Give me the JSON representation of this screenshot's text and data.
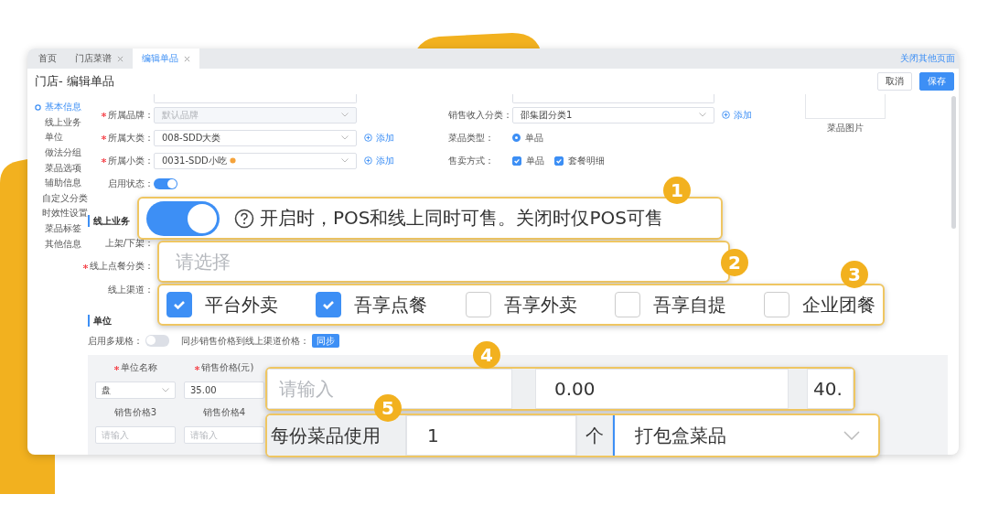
{
  "tabs": [
    {
      "label": "首页",
      "closable": false,
      "selected": false
    },
    {
      "label": "门店菜谱",
      "closable": true,
      "selected": false
    },
    {
      "label": "编辑单品",
      "closable": true,
      "selected": true
    }
  ],
  "tab_bar_link": "关闭其他页面",
  "page_title": "门店- 编辑单品",
  "header_buttons": [
    {
      "label": "取消",
      "kind": "default"
    },
    {
      "label": "保存",
      "kind": "primary"
    }
  ],
  "sidebar": {
    "items": [
      {
        "label": "基本信息",
        "selected": true
      },
      {
        "label": "线上业务",
        "selected": false
      },
      {
        "label": "单位",
        "selected": false
      },
      {
        "label": "做法分组",
        "selected": false
      },
      {
        "label": "菜品选项",
        "selected": false
      },
      {
        "label": "辅助信息",
        "selected": false
      },
      {
        "label": "自定义分类",
        "selected": false
      },
      {
        "label": "时效性设置",
        "selected": false
      },
      {
        "label": "菜品标签",
        "selected": false
      },
      {
        "label": "其他信息",
        "selected": false
      }
    ]
  },
  "basic_info": {
    "left_fields": [
      {
        "label": "所属品牌：",
        "required": true,
        "value": "默认品牌",
        "disabled": true
      },
      {
        "label": "所属大类：",
        "required": true,
        "value": "008-SDD大类",
        "disabled": false,
        "add_label": "添加"
      },
      {
        "label": "所属小类：",
        "required": true,
        "value": "0031-SDD小吃",
        "disabled": false,
        "add_label": "添加",
        "value_icon": true
      }
    ],
    "right_fields": [
      {
        "label": "销售收入分类：",
        "kind": "select",
        "value": "邵集团分类1",
        "add_label": "添加"
      },
      {
        "label": "菜品类型：",
        "kind": "radio",
        "options": [
          {
            "label": "单品",
            "selected": true
          }
        ]
      },
      {
        "label": "售卖方式：",
        "kind": "checkbox",
        "options": [
          {
            "label": "单品",
            "checked": true
          },
          {
            "label": "套餐明细",
            "checked": true
          }
        ]
      }
    ],
    "image_caption": "菜品图片",
    "status": {
      "label": "启用状态：",
      "on": true
    }
  },
  "online_business": {
    "title": "线上业务",
    "field_labels": [
      {
        "label": "上架/下架：",
        "required": false
      },
      {
        "label": "线上点餐分类：",
        "required": true
      },
      {
        "label": "线上渠道：",
        "required": false
      }
    ]
  },
  "unit": {
    "title": "单位",
    "multi_spec": {
      "label": "启用多规格：",
      "on": false
    },
    "sync": {
      "label": "同步销售价格到线上渠道价格：",
      "button": "同步"
    },
    "table": {
      "rows": [
        {
          "kind": "header",
          "cells": [
            {
              "text": "单位名称",
              "required": true
            },
            {
              "text": "销售价格(元)",
              "required": true
            }
          ]
        },
        {
          "kind": "fields",
          "cells": [
            {
              "kind": "select",
              "value": "盘"
            },
            {
              "kind": "input",
              "value": "35.00"
            }
          ]
        },
        {
          "kind": "header",
          "cells": [
            {
              "text": "销售价格3",
              "required": false
            },
            {
              "text": "销售价格4",
              "required": false
            }
          ]
        },
        {
          "kind": "fields",
          "cells": [
            {
              "kind": "input",
              "placeholder": "请输入"
            },
            {
              "kind": "input",
              "placeholder": "请输入"
            }
          ]
        }
      ]
    }
  },
  "callouts": [
    {
      "number": "1",
      "kind": "toggle",
      "on": true,
      "text": "开启时，POS和线上同时可售。关闭时仅POS可售"
    },
    {
      "number": "2",
      "kind": "select",
      "placeholder": "请选择"
    },
    {
      "number": "3",
      "kind": "checkboxes",
      "options": [
        {
          "label": "平台外卖",
          "checked": true
        },
        {
          "label": "吾享点餐",
          "checked": true
        },
        {
          "label": "吾享外卖",
          "checked": false
        },
        {
          "label": "吾享自提",
          "checked": false
        },
        {
          "label": "企业团餐",
          "checked": false
        }
      ]
    },
    {
      "number": "4",
      "kind": "inputs",
      "cells": [
        {
          "placeholder": "请输入"
        },
        {
          "value": "0.00"
        },
        {
          "value": "40."
        }
      ]
    },
    {
      "number": "5",
      "kind": "unit_usage",
      "label": "每份菜品使用",
      "value": "1",
      "unit": "个",
      "select_value": "打包盒菜品"
    }
  ]
}
